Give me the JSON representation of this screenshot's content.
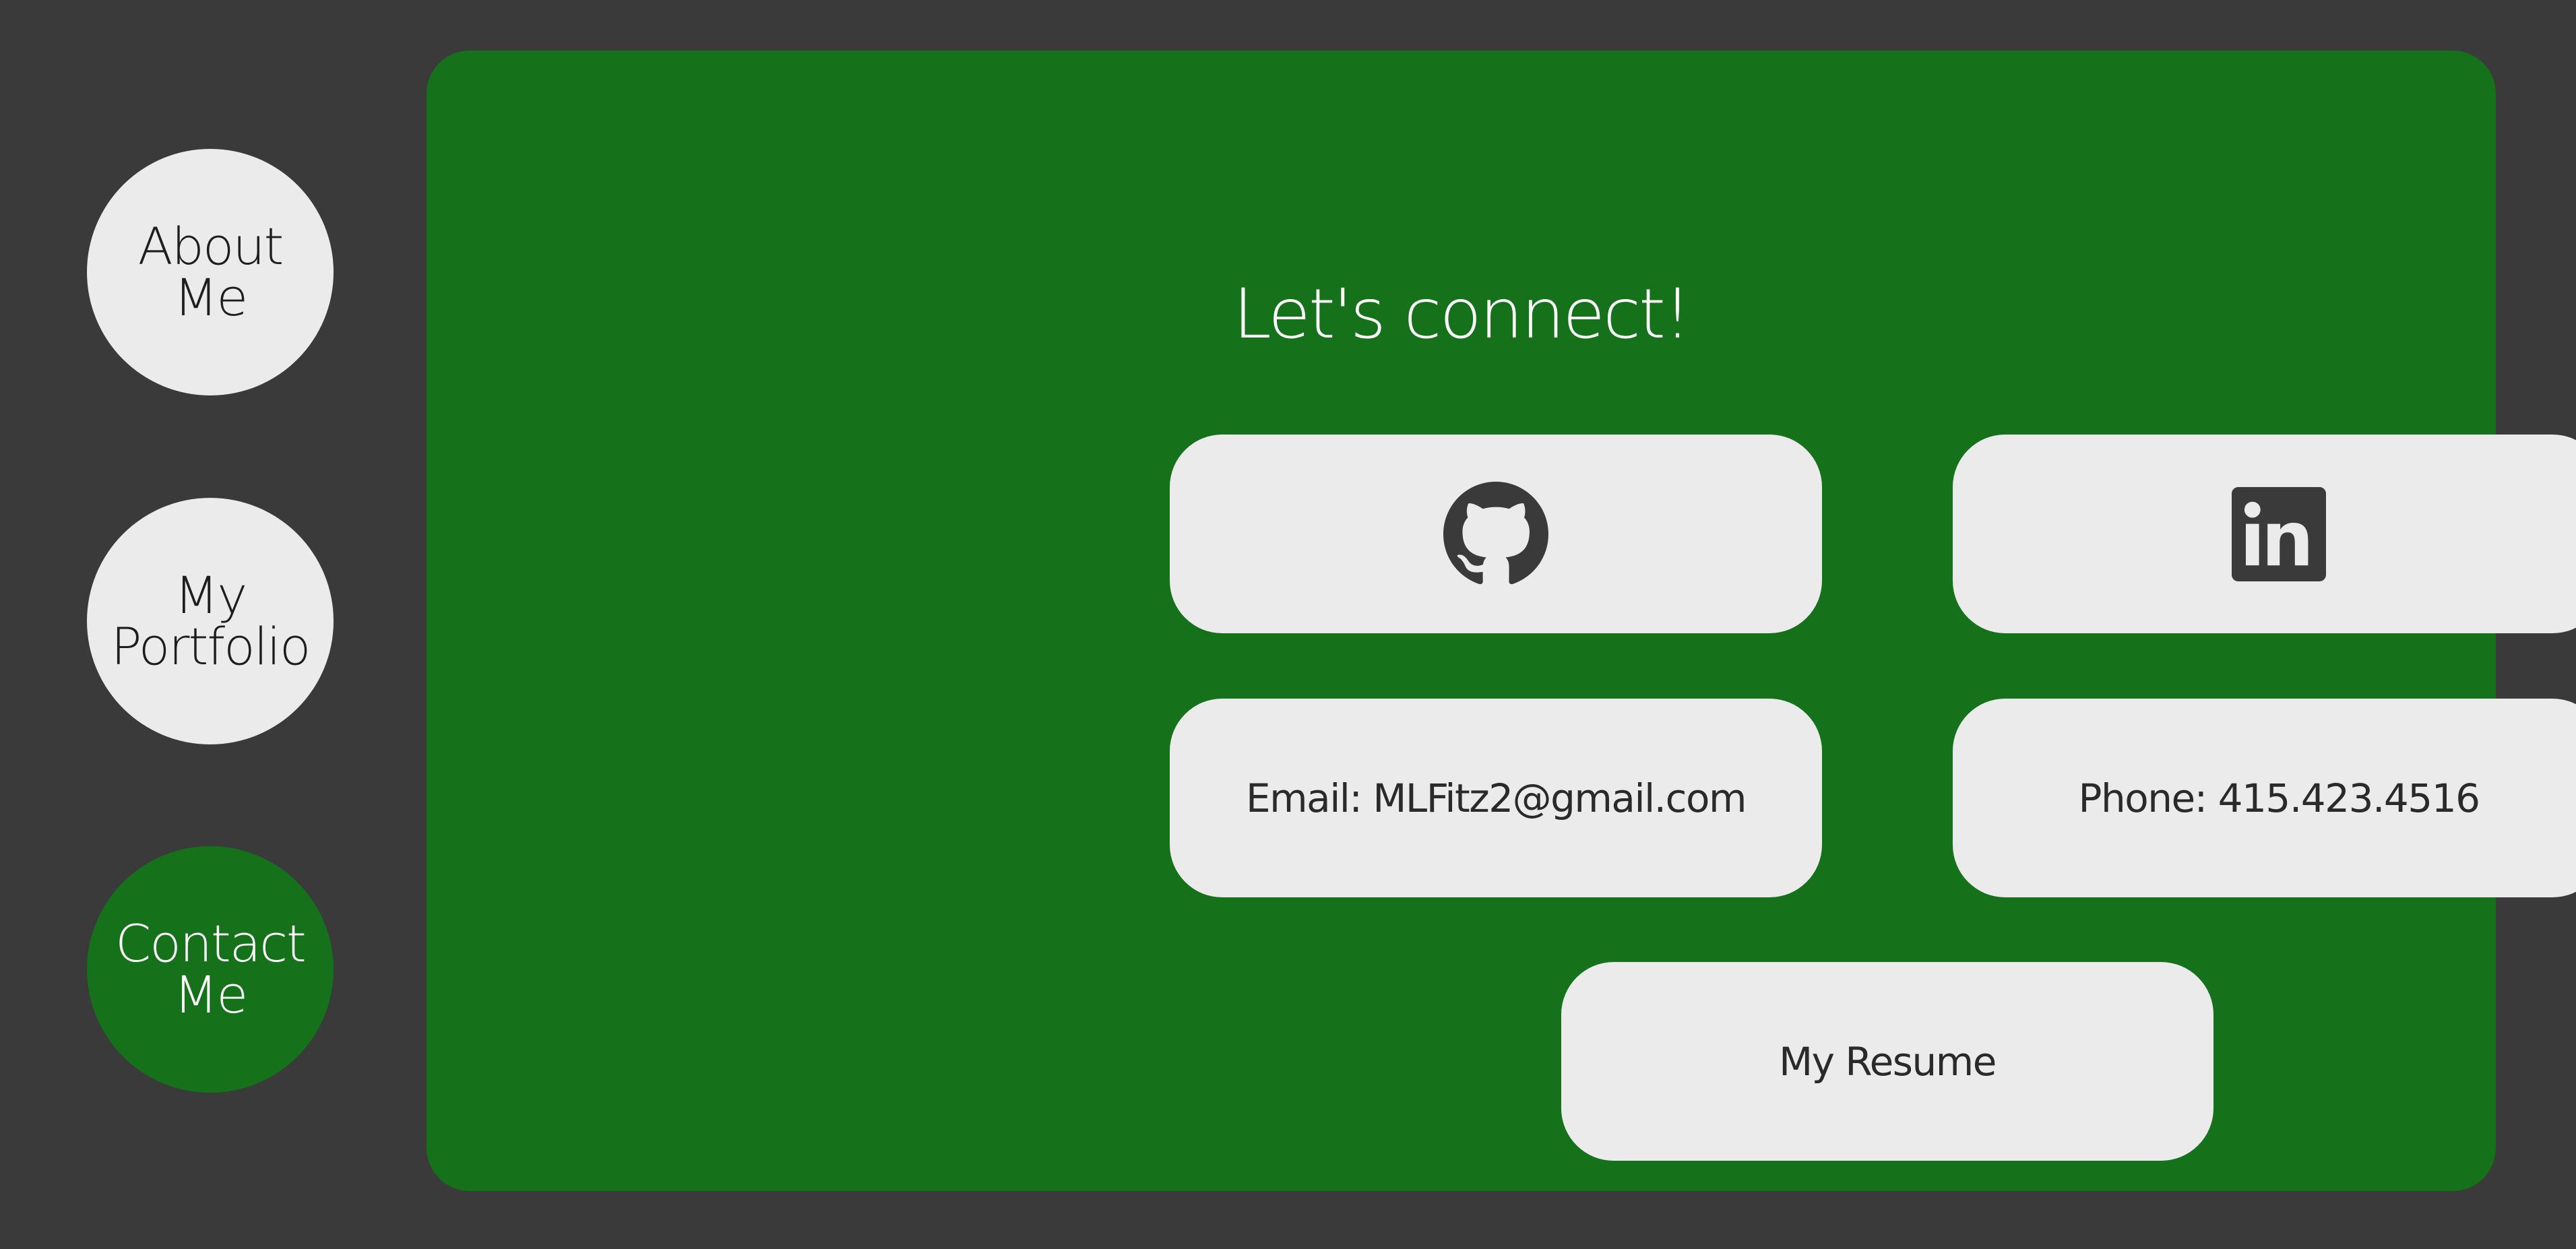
{
  "nav": {
    "about": "About\nMe",
    "portfolio": "My\nPortfolio",
    "contact": "Contact\nMe"
  },
  "main": {
    "heading": "Let's connect!",
    "links": {
      "github_icon": "github-icon",
      "linkedin_icon": "linkedin-icon",
      "email": "Email: MLFitz2@gmail.com",
      "phone": "Phone: 415.423.4516",
      "resume": "My Resume"
    }
  },
  "colors": {
    "background": "#3a3a3a",
    "accent_green": "#15711a",
    "card": "#ebebeb",
    "icon": "#3a3a3a"
  }
}
